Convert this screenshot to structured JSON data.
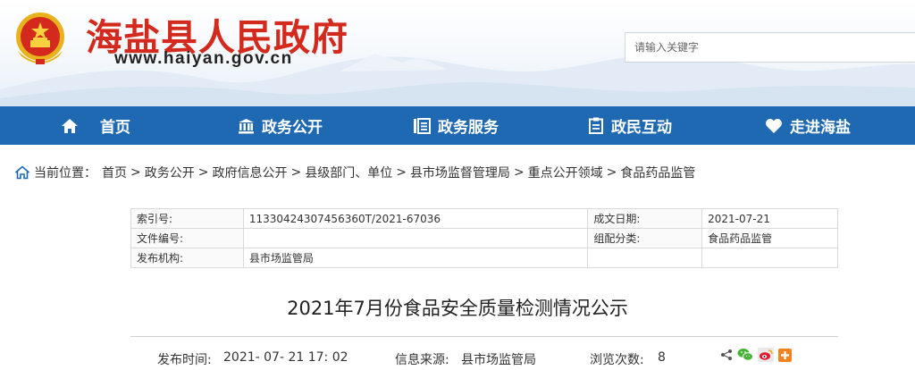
{
  "header": {
    "site_title": "海盐县人民政府",
    "site_url": "www.haiyan.gov.cn",
    "search_placeholder": "请输入关键字",
    "title_color": "#d42a1d"
  },
  "nav": {
    "background": "#1f69b3",
    "items": [
      {
        "label": "首页",
        "icon": "home-icon"
      },
      {
        "label": "政务公开",
        "icon": "building-icon"
      },
      {
        "label": "政务服务",
        "icon": "document-icon"
      },
      {
        "label": "政民互动",
        "icon": "clipboard-icon"
      },
      {
        "label": "走进海盐",
        "icon": "heart-icon"
      }
    ]
  },
  "breadcrumb": {
    "prefix": "当前位置：",
    "separator": ">",
    "items": [
      "首页",
      "政务公开",
      "政府信息公开",
      "县级部门、单位",
      "县市场监督管理局",
      "重点公开领域",
      "食品药品监管"
    ]
  },
  "meta": {
    "index_label": "索引号:",
    "index_value": "11330424307456360T/2021-67036",
    "date_label": "成文日期:",
    "date_value": "2021-07-21",
    "doc_no_label": "文件编号:",
    "doc_no_value": "",
    "category_label": "组配分类:",
    "category_value": "食品药品监管",
    "org_label": "发布机构:",
    "org_value": "县市场监管局"
  },
  "article": {
    "title": "2021年7月份食品安全质量检测情况公示",
    "publish_label": "发布时间:",
    "publish_value": "2021- 07- 21 17: 02",
    "source_label": "信息来源:",
    "source_value": "县市场监管局",
    "views_label": "浏览次数:",
    "views_value": "8"
  },
  "share": {
    "icons": [
      "share-icon",
      "wechat-icon",
      "weibo-icon",
      "more-share-icon"
    ]
  }
}
